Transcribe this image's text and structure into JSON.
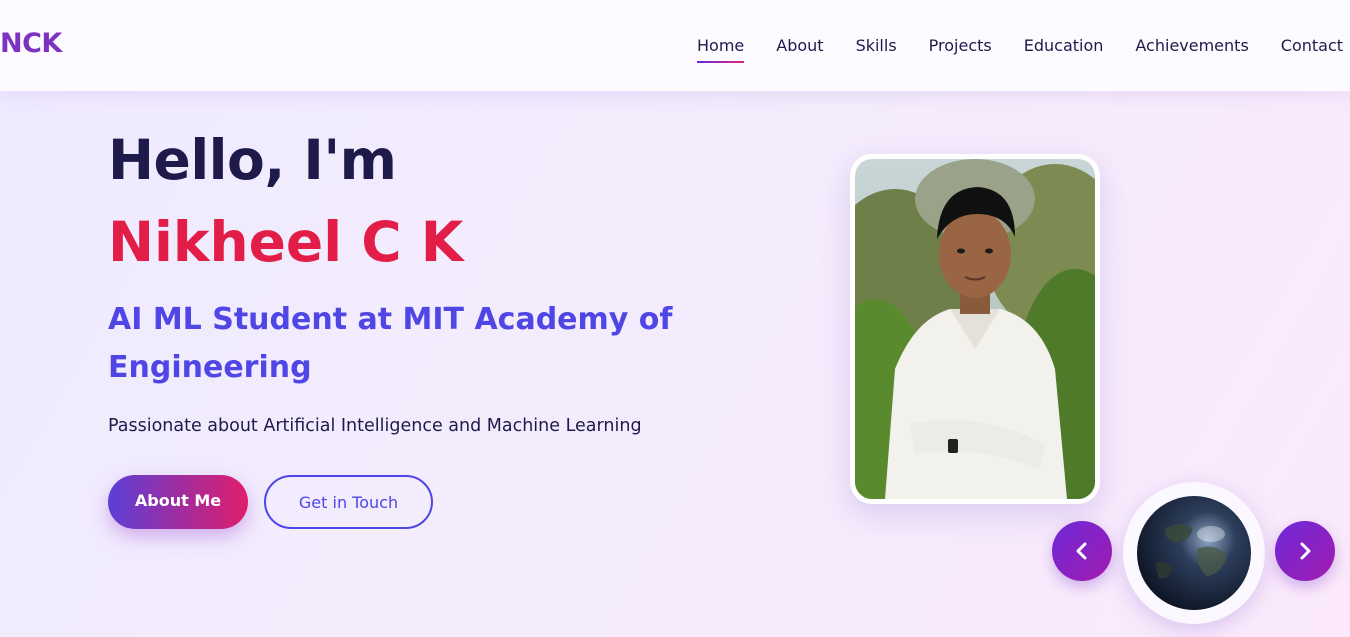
{
  "header": {
    "logo": "NCK",
    "nav": [
      {
        "label": "Home",
        "active": true
      },
      {
        "label": "About",
        "active": false
      },
      {
        "label": "Skills",
        "active": false
      },
      {
        "label": "Projects",
        "active": false
      },
      {
        "label": "Education",
        "active": false
      },
      {
        "label": "Achievements",
        "active": false
      },
      {
        "label": "Contact",
        "active": false
      }
    ]
  },
  "hero": {
    "greeting": "Hello, I'm",
    "name": "Nikheel C K",
    "role": "AI ML Student at MIT Academy of Engineering",
    "tagline": "Passionate about Artificial Intelligence and Machine Learning",
    "primary_button": "About Me",
    "secondary_button": "Get in Touch"
  },
  "profile": {
    "photo_icon": "profile-photo",
    "prev_icon": "chevron-left-icon",
    "next_icon": "chevron-right-icon",
    "globe_icon": "globe-icon"
  },
  "colors": {
    "logo": "#7b33c0",
    "heading": "#1e1b4b",
    "name": "#e11d48",
    "role": "#4f46e5",
    "button_gradient_start": "#5b3fd6",
    "button_gradient_end": "#e11d6b",
    "carousel_button": "#7e22ce"
  }
}
